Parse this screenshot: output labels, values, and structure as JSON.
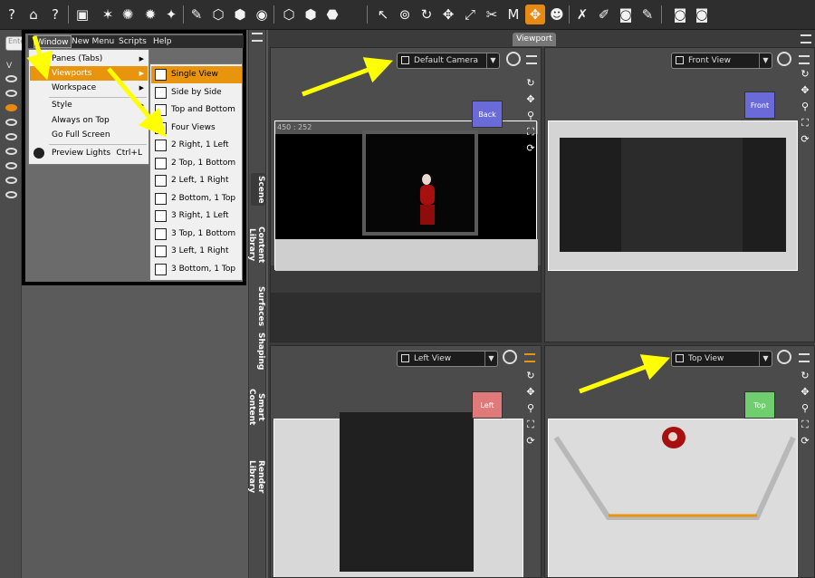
{
  "menubar": {
    "items": [
      "Window",
      "New Menu",
      "Scripts",
      "Help"
    ],
    "active": "Window"
  },
  "window_menu": {
    "items": [
      {
        "label": "Panes (Tabs)",
        "submenu": true
      },
      {
        "label": "Viewports",
        "submenu": true,
        "highlighted": true
      },
      {
        "label": "Workspace",
        "submenu": true
      },
      {
        "label": "Style",
        "submenu": true
      },
      {
        "label": "Always on Top"
      },
      {
        "label": "Go Full Screen"
      },
      {
        "label": "Preview Lights",
        "shortcut": "Ctrl+L"
      }
    ]
  },
  "viewports_submenu": {
    "items": [
      {
        "label": "Single View",
        "highlighted": true
      },
      {
        "label": "Side by Side"
      },
      {
        "label": "Top and Bottom"
      },
      {
        "label": "Four Views"
      },
      {
        "label": "2 Right, 1 Left"
      },
      {
        "label": "2 Top, 1 Bottom"
      },
      {
        "label": "2 Left, 1 Right"
      },
      {
        "label": "2 Bottom, 1 Top"
      },
      {
        "label": "3 Right, 1 Left"
      },
      {
        "label": "3 Top, 1 Bottom"
      },
      {
        "label": "3 Left, 1 Right"
      },
      {
        "label": "3 Bottom, 1 Top"
      }
    ]
  },
  "left_panel": {
    "search_placeholder": "Ente",
    "column_header": "V"
  },
  "side_tabs": [
    "Scene",
    "Content Library",
    "Surfaces",
    "Shaping",
    "Smart Content",
    "Render Library"
  ],
  "viewport_tab": "Viewport",
  "viewports": [
    {
      "camera": "Default Camera",
      "cube_label": "Back",
      "cube_color": "#6a6ad8",
      "readout": "450 : 252"
    },
    {
      "camera": "Front View",
      "cube_label": "Front",
      "cube_color": "#6a6ad8"
    },
    {
      "camera": "Left View",
      "cube_label": "Left",
      "cube_color": "#e07a7a"
    },
    {
      "camera": "Top View",
      "cube_label": "Top",
      "cube_color": "#6fcf6f"
    }
  ],
  "colors": {
    "accent": "#e8940d",
    "arrow": "#ffff00",
    "menu_bg": "#f0f0f0",
    "toolbar_bg": "#2e2e2e"
  }
}
